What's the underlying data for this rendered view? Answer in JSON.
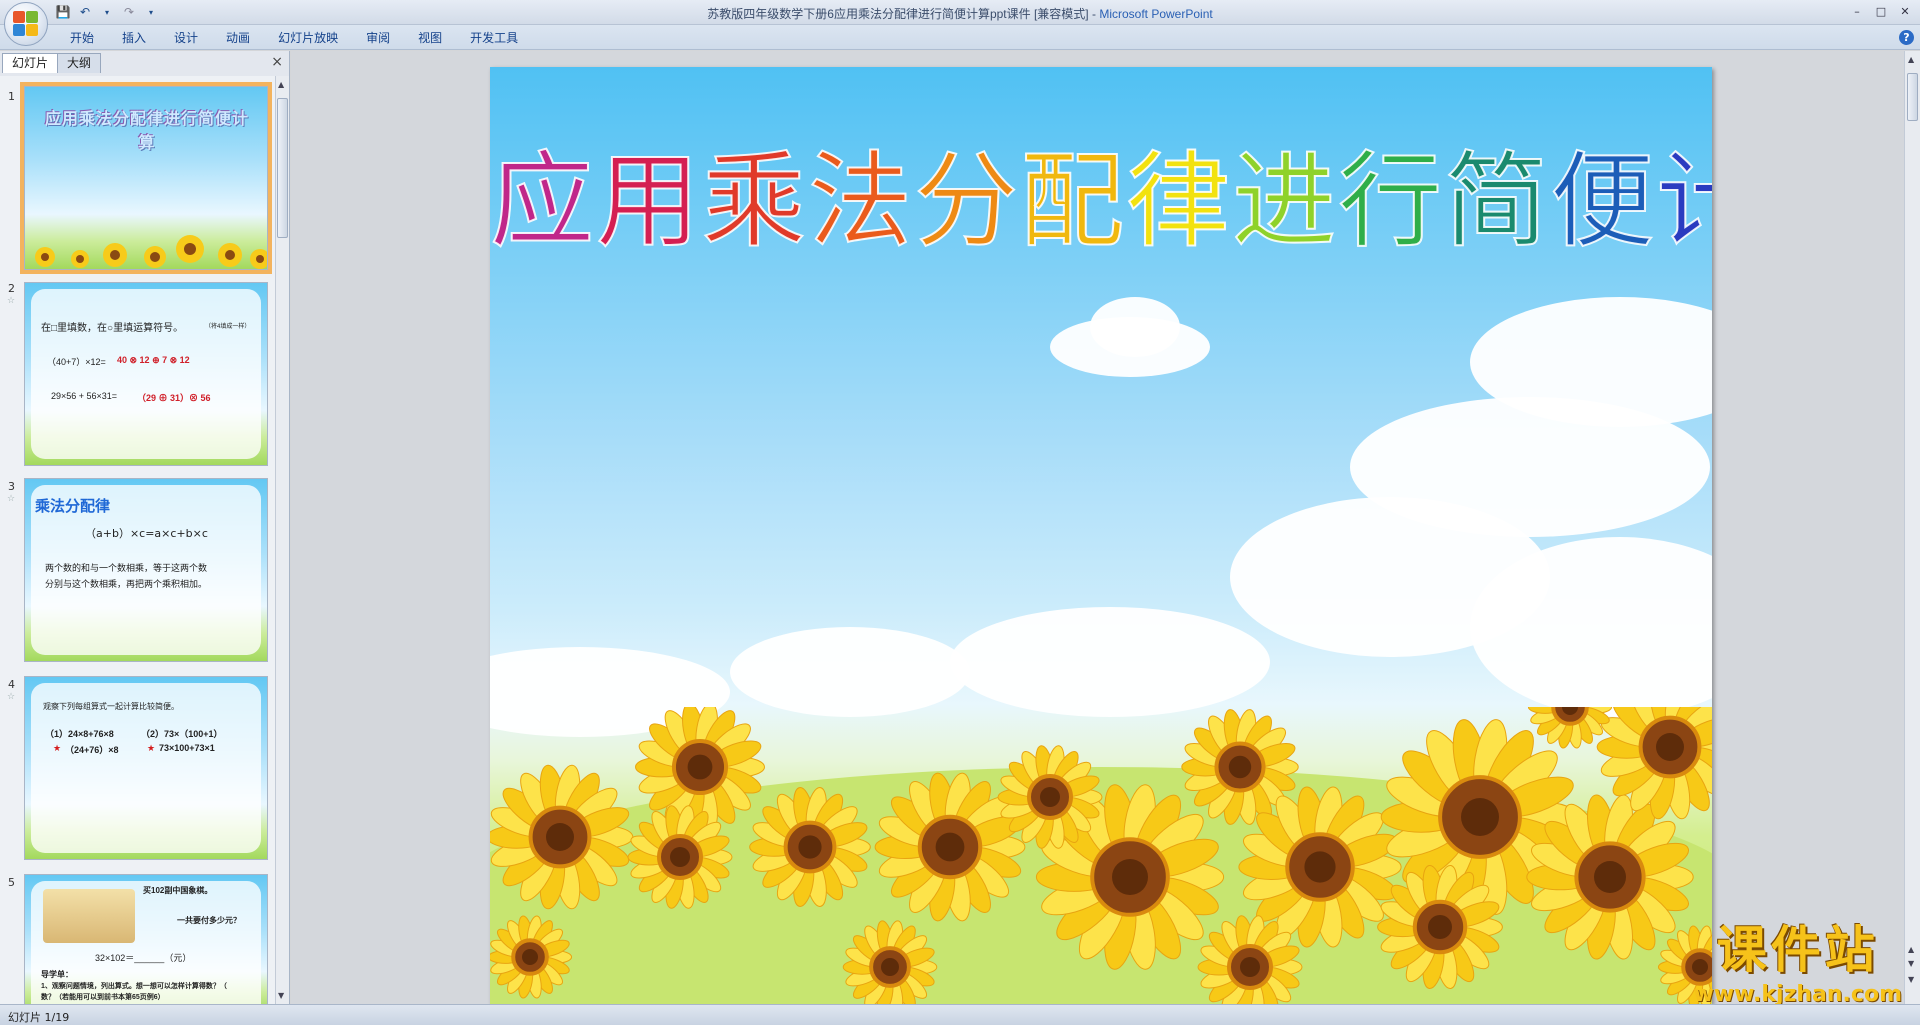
{
  "window": {
    "title_doc": "苏教版四年级数学下册6应用乘法分配律进行简便计算ppt课件 [兼容模式]",
    "title_sep": " - ",
    "title_app": "Microsoft PowerPoint"
  },
  "ribbon": {
    "tabs": [
      "开始",
      "插入",
      "设计",
      "动画",
      "幻灯片放映",
      "审阅",
      "视图",
      "开发工具"
    ]
  },
  "pane": {
    "tabs": [
      "幻灯片",
      "大纲"
    ],
    "close": "×"
  },
  "thumbs": [
    {
      "num": "1",
      "title": "应用乘法分配律进行简便计算"
    },
    {
      "num": "2",
      "instr": "在□里填数，在○里填运算符号。",
      "instr_small": "（将4填成一样）",
      "line1": "（40+7）×12=",
      "line1_ans": "40 ⊗ 12 ⊕ 7 ⊗ 12",
      "line2": "29×56 + 56×31=",
      "line2_ans": "（29 ⊕ 31）⊗ 56"
    },
    {
      "num": "3",
      "title": "乘法分配律",
      "formula": "（a+b）×c=a×c+b×c",
      "desc1": "两个数的和与一个数相乘，等于这两个数",
      "desc2": "分别与这个数相乘，再把两个乘积相加。"
    },
    {
      "num": "4",
      "instr": "观察下列每组算式一起计算比较简便。",
      "q1": "（1）24×8+76×8",
      "q2": "（2）73×（100+1）",
      "a1": "（24+76）×8",
      "a2": "73×100+73×1"
    },
    {
      "num": "5",
      "bubble1": "买102副中国象棋。",
      "bubble2": "一共要付多少元？",
      "eq": "32×102＝______（元）",
      "guide": "导学单：",
      "g1": "1、观察问题情境，列出算式。想一想可以怎样计算得数？（",
      "g2": "数？（若能用可以到前书本第65页例6）"
    }
  ],
  "slide": {
    "title_chars": [
      "应",
      "用",
      "乘",
      "法",
      "分",
      "配",
      "律",
      "进",
      "行",
      "简",
      "便",
      "计",
      "算"
    ],
    "title_colors": [
      "#c0278a",
      "#d41f52",
      "#e03a2a",
      "#ea5b1c",
      "#ee8a14",
      "#f0b80e",
      "#f2e20f",
      "#8fd22a",
      "#2fae49",
      "#1a8a6e",
      "#1c5db8",
      "#2a3bc0",
      "#6a2bc2"
    ]
  },
  "watermark": {
    "main": "课件站",
    "sub": "www.kjzhan.com"
  },
  "status": {
    "text": "幻灯片 1/19"
  }
}
